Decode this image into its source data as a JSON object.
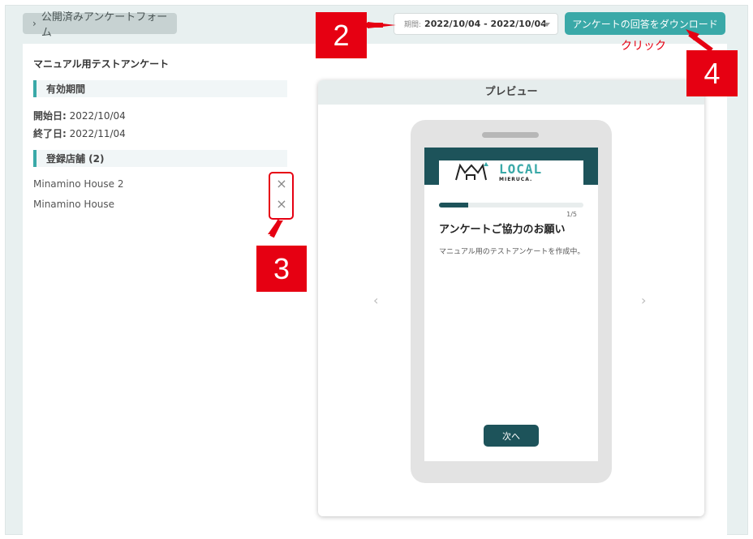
{
  "header": {
    "breadcrumb_label": "公開済みアンケートフォーム",
    "date_range": {
      "label": "期間:",
      "value": "2022/10/04 - 2022/10/04"
    },
    "download_label": "アンケートの回答をダウンロード"
  },
  "survey": {
    "title": "マニュアル用テストアンケート",
    "validity_section": "有効期間",
    "start_label": "開始日:",
    "start_value": "2022/10/04",
    "end_label": "終了日:",
    "end_value": "2022/11/04",
    "stores_section": "登録店舗 (2)",
    "stores": [
      {
        "name": "Minamino House 2"
      },
      {
        "name": "Minamino House"
      }
    ]
  },
  "preview": {
    "title": "プレビュー",
    "logo_main": "LOCAL",
    "logo_sub": "MIERUCA.",
    "progress_fraction": 0.2,
    "page_count": "1/5",
    "screen_title": "アンケートご協力のお願い",
    "screen_description": "マニュアル用のテストアンケートを作成中。",
    "next_label": "次へ"
  },
  "annotations": {
    "callout_2": "2",
    "callout_3": "3",
    "callout_4": "4",
    "click_text": "クリック",
    "color": "#e60012"
  },
  "colors": {
    "accent": "#3aa9a8",
    "dark_teal": "#1d535a"
  }
}
